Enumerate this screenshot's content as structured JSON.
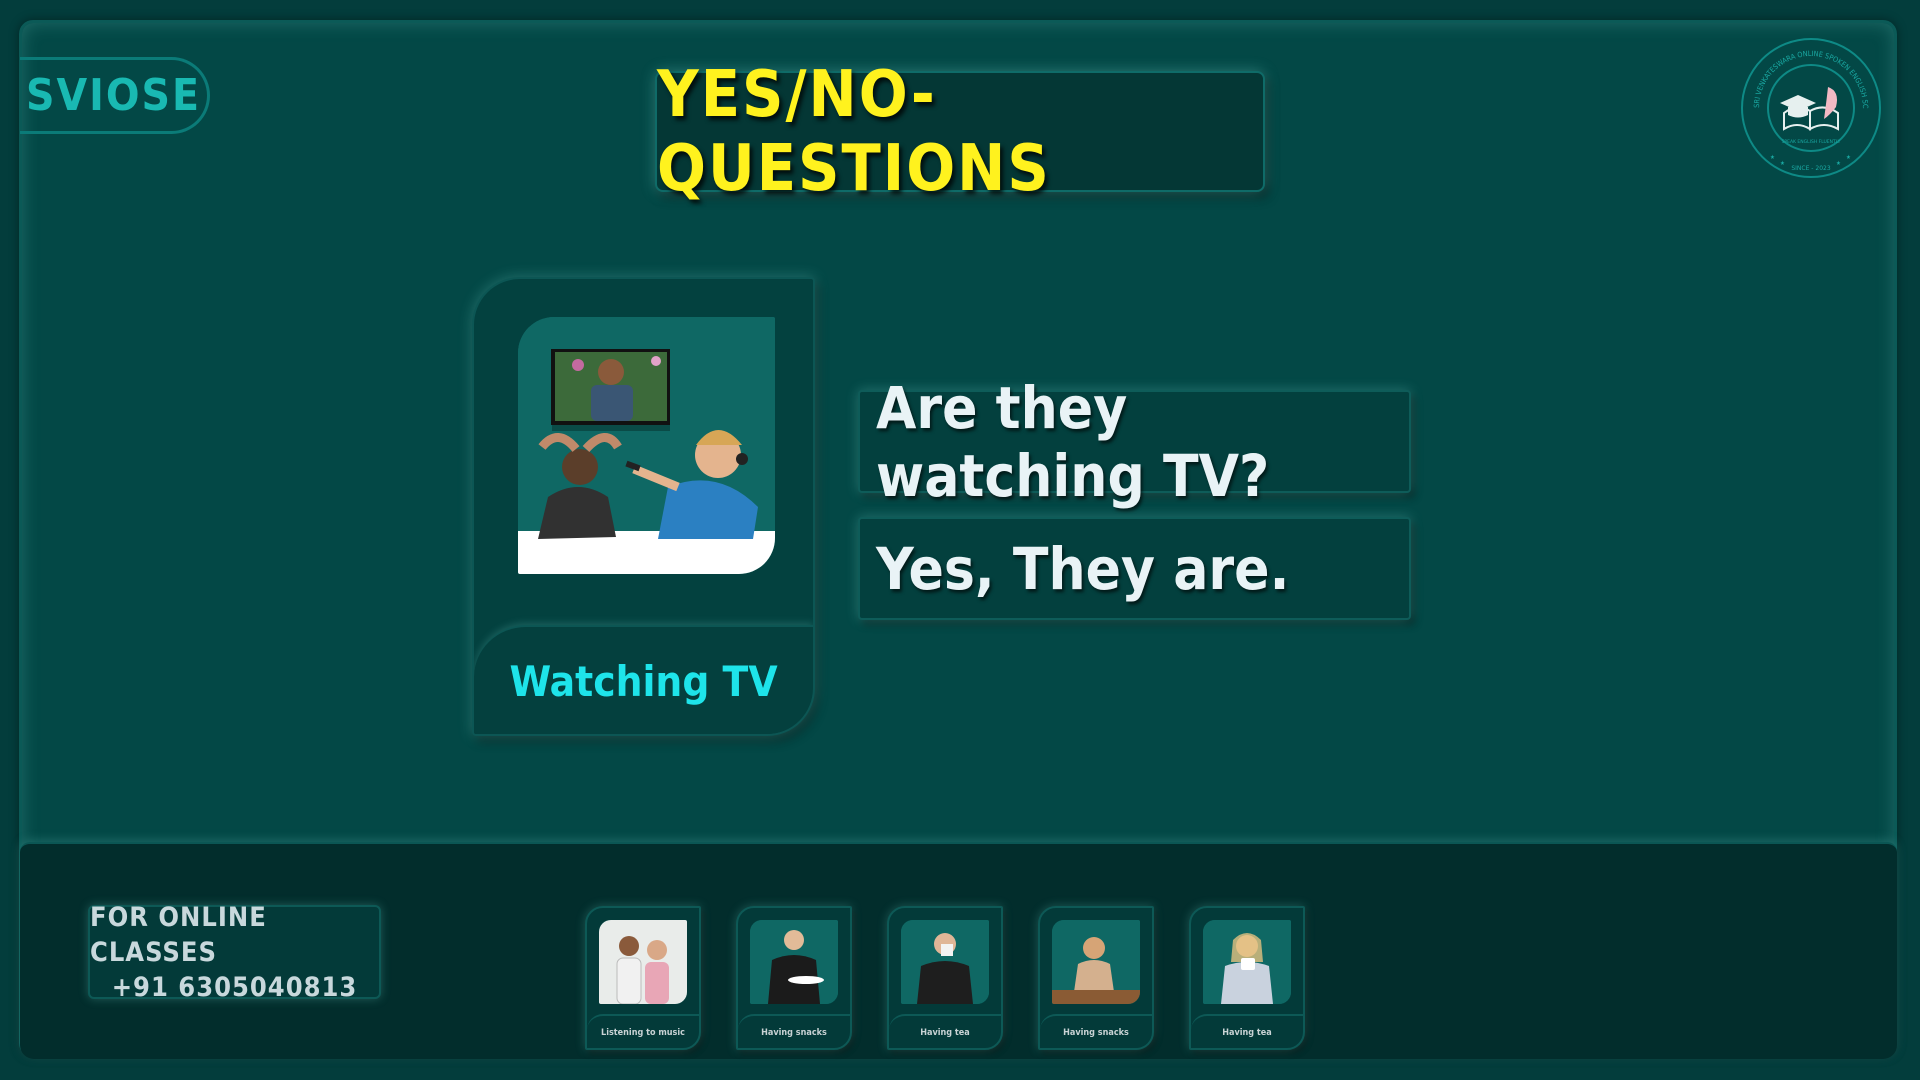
{
  "brand": {
    "name": "SVIOSE"
  },
  "header": {
    "title": "YES/NO-QUESTIONS"
  },
  "logo": {
    "ring_text": "SRI VENKATESWARA ONLINE SPOKEN ENGLISH SCHOOL",
    "motto": "SPEAK ENGLISH FLUENTLY",
    "since": "SINCE - 2023",
    "icon": "book-graduation-cap-quill-icon"
  },
  "main_card": {
    "label": "Watching TV",
    "image": "two-men-watching-tv-image"
  },
  "qa": {
    "question": "Are they watching TV?",
    "answer": "Yes, They are."
  },
  "footer": {
    "contact_line1": "FOR ONLINE CLASSES",
    "contact_line2": "+91 6305040813",
    "thumbnails": [
      {
        "label": "Listening to music",
        "image": "two-women-headphones-image"
      },
      {
        "label": "Having snacks",
        "image": "man-holding-plate-image"
      },
      {
        "label": "Having tea",
        "image": "man-drinking-cup-image"
      },
      {
        "label": "Having snacks",
        "image": "woman-eating-at-table-image"
      },
      {
        "label": "Having tea",
        "image": "woman-holding-cup-image"
      }
    ]
  },
  "colors": {
    "background": "#034846",
    "title_text": "#fff21e",
    "label_cyan": "#1ee4ea",
    "brand_teal": "#19b9b2",
    "question_text": "#e9f3f6"
  }
}
